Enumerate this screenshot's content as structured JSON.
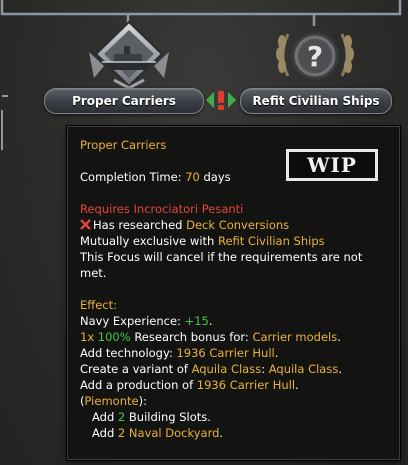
{
  "focus_tree": {
    "left_focus": {
      "label": "Proper Carriers",
      "icon": "carrier-ship-icon"
    },
    "right_focus": {
      "label": "Refit Civilian Ships",
      "icon": "unknown-question-icon"
    },
    "exclusive_icon": "mutually-exclusive-icon"
  },
  "tooltip": {
    "title": "Proper Carriers",
    "completion_label": "Completion Time: ",
    "completion_value": "70",
    "completion_unit": " days",
    "wip_label": "WIP",
    "requires": "Requires Incrociatori Pesanti",
    "has_researched_prefix": "Has researched ",
    "has_researched_value": "Deck Conversions",
    "exclusive_prefix": "Mutually exclusive with ",
    "exclusive_value": "Refit Civilian Ships",
    "cancel_line1": "This Focus will cancel if the requirements are not",
    "cancel_line2": "met.",
    "effect_label": "Effect:",
    "navy_xp_label": "Navy Experience: ",
    "navy_xp_value": "+15",
    "navy_xp_end": ".",
    "research_count": "1x ",
    "research_pct": "100%",
    "research_mid": " Research bonus for: ",
    "research_value": "Carrier models",
    "research_end": ".",
    "tech_prefix": "Add technology: ",
    "tech_value": "1936 Carrier Hull",
    "tech_end": ".",
    "variant_prefix": "Create a variant of ",
    "variant_class": "Aquila Class",
    "variant_mid": ": ",
    "variant_name": "Aquila Class",
    "variant_end": ".",
    "production_prefix": "Add a production of ",
    "production_value": "1936 Carrier Hull",
    "production_end": ".",
    "state_open": "(",
    "state_name": "Piemonte",
    "state_close": "):",
    "building_prefix": "Add ",
    "building_count": "2",
    "building_suffix": " Building Slots.",
    "dockyard_prefix": "Add ",
    "dockyard_count": "2",
    "dockyard_value": " Naval Dockyard",
    "dockyard_end": "."
  }
}
